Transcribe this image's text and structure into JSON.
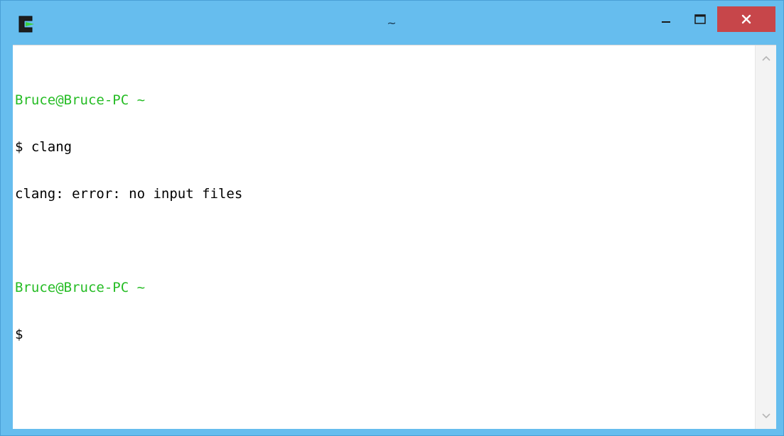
{
  "window": {
    "title": "~",
    "colors": {
      "frame": "#66bdee",
      "close_button": "#c7464a",
      "prompt_green": "#25bc24"
    }
  },
  "titlebar": {
    "app_icon": "cygwin-terminal-icon",
    "minimize_icon": "minimize-icon",
    "maximize_icon": "maximize-icon",
    "close_icon": "close-icon"
  },
  "terminal": {
    "lines": [
      {
        "text": "Bruce@Bruce-PC ~",
        "style": "prompt"
      },
      {
        "text": "$ clang",
        "style": "normal"
      },
      {
        "text": "clang: error: no input files",
        "style": "normal"
      },
      {
        "text": "",
        "style": "normal"
      },
      {
        "text": "Bruce@Bruce-PC ~",
        "style": "prompt"
      },
      {
        "text": "$",
        "style": "normal"
      }
    ]
  },
  "scrollbar": {
    "up_icon": "chevron-up-icon",
    "down_icon": "chevron-down-icon"
  }
}
